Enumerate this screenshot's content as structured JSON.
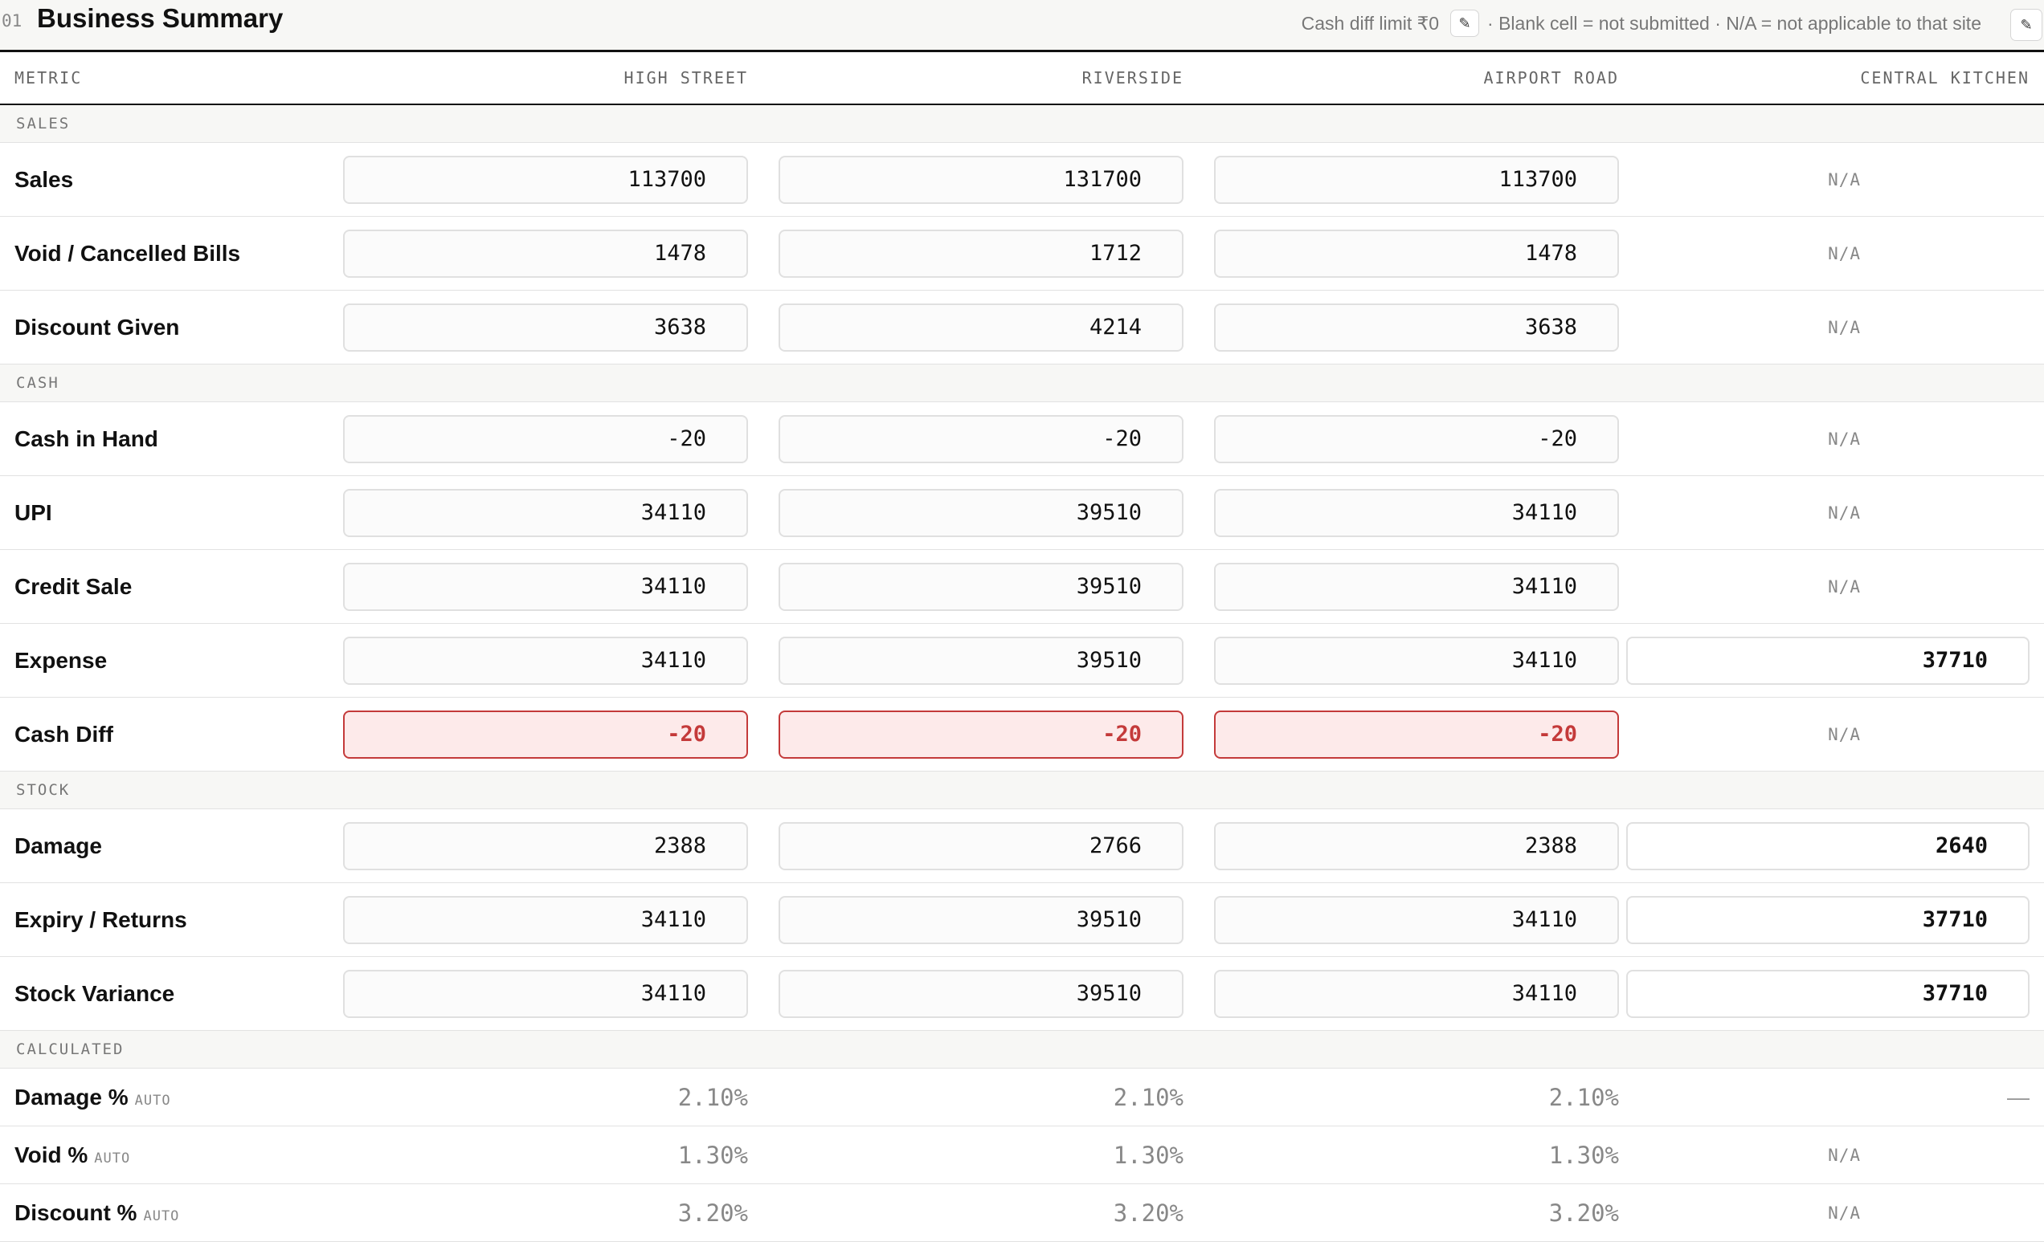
{
  "header": {
    "section_number": "01",
    "title": "Business Summary",
    "cash_diff_limit": "Cash diff limit ₹0",
    "legend": "· Blank cell = not submitted · N/A = not applicable to that site",
    "edit_icon": "pencil-icon"
  },
  "columns": [
    "METRIC",
    "HIGH STREET",
    "RIVERSIDE",
    "AIRPORT ROAD",
    "CENTRAL KITCHEN"
  ],
  "groups": {
    "sales": "SALES",
    "cash": "CASH",
    "stock": "STOCK",
    "calculated": "CALCULATED"
  },
  "na_label": "N/A",
  "dash_label": "—",
  "auto_label": "AUTO",
  "rows": {
    "sales": {
      "label": "Sales",
      "values": [
        "113700",
        "131700",
        "113700"
      ]
    },
    "void": {
      "label": "Void / Cancelled Bills",
      "values": [
        "1478",
        "1712",
        "1478"
      ]
    },
    "discount": {
      "label": "Discount Given",
      "values": [
        "3638",
        "4214",
        "3638"
      ]
    },
    "cash_in_hand": {
      "label": "Cash in Hand",
      "values": [
        "-20",
        "-20",
        "-20"
      ]
    },
    "upi": {
      "label": "UPI",
      "values": [
        "34110",
        "39510",
        "34110"
      ]
    },
    "credit": {
      "label": "Credit Sale",
      "values": [
        "34110",
        "39510",
        "34110"
      ]
    },
    "expense": {
      "label": "Expense",
      "values": [
        "34110",
        "39510",
        "34110",
        "37710"
      ]
    },
    "cash_diff": {
      "label": "Cash Diff",
      "values": [
        "-20",
        "-20",
        "-20"
      ]
    },
    "damage": {
      "label": "Damage",
      "values": [
        "2388",
        "2766",
        "2388",
        "2640"
      ]
    },
    "expiry": {
      "label": "Expiry / Returns",
      "values": [
        "34110",
        "39510",
        "34110",
        "37710"
      ]
    },
    "variance": {
      "label": "Stock Variance",
      "values": [
        "34110",
        "39510",
        "34110",
        "37710"
      ]
    },
    "damage_pct": {
      "label": "Damage %",
      "values": [
        "2.10%",
        "2.10%",
        "2.10%"
      ]
    },
    "void_pct": {
      "label": "Void %",
      "values": [
        "1.30%",
        "1.30%",
        "1.30%"
      ]
    },
    "discount_pct": {
      "label": "Discount %",
      "values": [
        "3.20%",
        "3.20%",
        "3.20%"
      ]
    }
  },
  "colors": {
    "alert": "#c43a3a",
    "alert_bg": "#fdeaea",
    "header_bg": "#f7f7f5"
  }
}
